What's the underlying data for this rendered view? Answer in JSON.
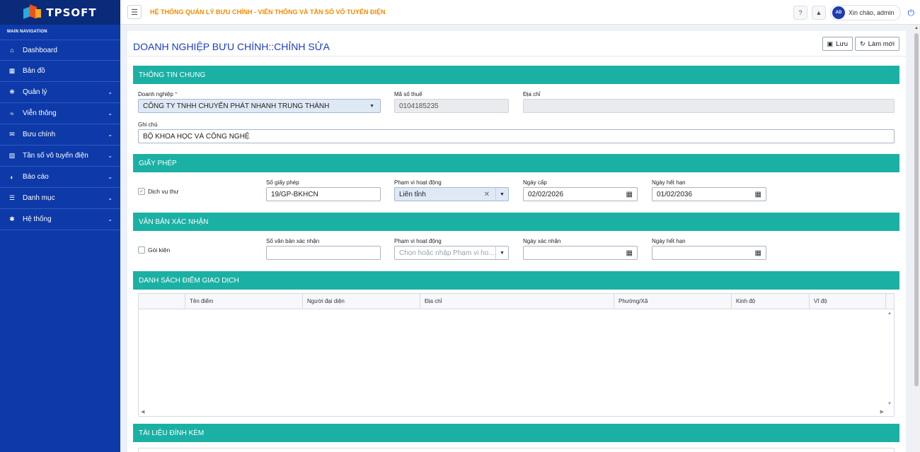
{
  "brand": {
    "name": "TPSOFT"
  },
  "sidebar": {
    "heading": "MAIN NAVIGATION",
    "items": [
      {
        "label": "Dashboard",
        "icon": "home-icon",
        "has_children": false
      },
      {
        "label": "Bản đồ",
        "icon": "map-icon",
        "has_children": false
      },
      {
        "label": "Quản lý",
        "icon": "gear-icon",
        "has_children": true
      },
      {
        "label": "Viễn thông",
        "icon": "wifi-icon",
        "has_children": true
      },
      {
        "label": "Bưu chính",
        "icon": "envelope-icon",
        "has_children": true
      },
      {
        "label": "Tần số vô tuyến điện",
        "icon": "radio-icon",
        "has_children": true
      },
      {
        "label": "Báo cáo",
        "icon": "pie-chart-icon",
        "has_children": true
      },
      {
        "label": "Danh mục",
        "icon": "list-icon",
        "has_children": true
      },
      {
        "label": "Hệ thống",
        "icon": "cog-icon",
        "has_children": true
      }
    ]
  },
  "header": {
    "system_title": "HỆ THỐNG QUẢN LÝ BƯU CHÍNH - VIỄN THÔNG VÀ TẦN SỐ VÔ TUYẾN ĐIỆN",
    "avatar_initials": "AD",
    "greeting": "Xin chào, admin"
  },
  "page": {
    "title": "DOANH NGHIỆP BƯU CHÍNH::CHỈNH SỬA",
    "save_label": "Lưu",
    "refresh_label": "Làm mới"
  },
  "general": {
    "heading": "THÔNG TIN CHUNG",
    "enterprise_label": "Doanh nghiệp",
    "required_mark": "*",
    "enterprise_value": "CÔNG TY TNHH CHUYỂN PHÁT NHANH TRUNG THÀNH",
    "tax_label": "Mã số thuế",
    "tax_value": "0104185235",
    "address_label": "Địa chỉ",
    "address_value": "",
    "note_label": "Ghi chú",
    "note_value": "BỘ KHOA HỌC VÀ CÔNG NGHỆ"
  },
  "license": {
    "heading": "GIẤY PHÉP",
    "checkbox_label": "Dịch vụ thư",
    "checked": true,
    "number_label": "Số giấy phép",
    "number_value": "19/GP-BKHCN",
    "scope_label": "Phạm vi hoạt động",
    "scope_value": "Liên tỉnh",
    "issue_label": "Ngày cấp",
    "issue_value": "02/02/2026",
    "expiry_label": "Ngày hết hạn",
    "expiry_value": "01/02/2036"
  },
  "confirm": {
    "heading": "VĂN BẢN XÁC NHẬN",
    "checkbox_label": "Gói kiện",
    "checked": false,
    "number_label": "Số văn bản xác nhận",
    "number_value": "",
    "scope_label": "Phạm vi hoạt động",
    "scope_placeholder": "Chọn hoặc nhập Phạm vi ho...",
    "confirm_date_label": "Ngày xác nhận",
    "confirm_date_value": "",
    "expiry_label": "Ngày hết hạn",
    "expiry_value": ""
  },
  "points": {
    "heading": "DANH SÁCH ĐIỂM GIAO DỊCH",
    "columns": [
      "",
      "Tên điểm",
      "Người đại diện",
      "Địa chỉ",
      "Phường/Xã",
      "Kinh độ",
      "Vĩ độ"
    ]
  },
  "attachments": {
    "heading": "TÀI LIỆU ĐÍNH KÈM"
  },
  "colors": {
    "sidebar": "#0d3aa8",
    "section_header": "#1bb0a4",
    "title": "#1a3fc0",
    "system_title": "#f28b00"
  }
}
